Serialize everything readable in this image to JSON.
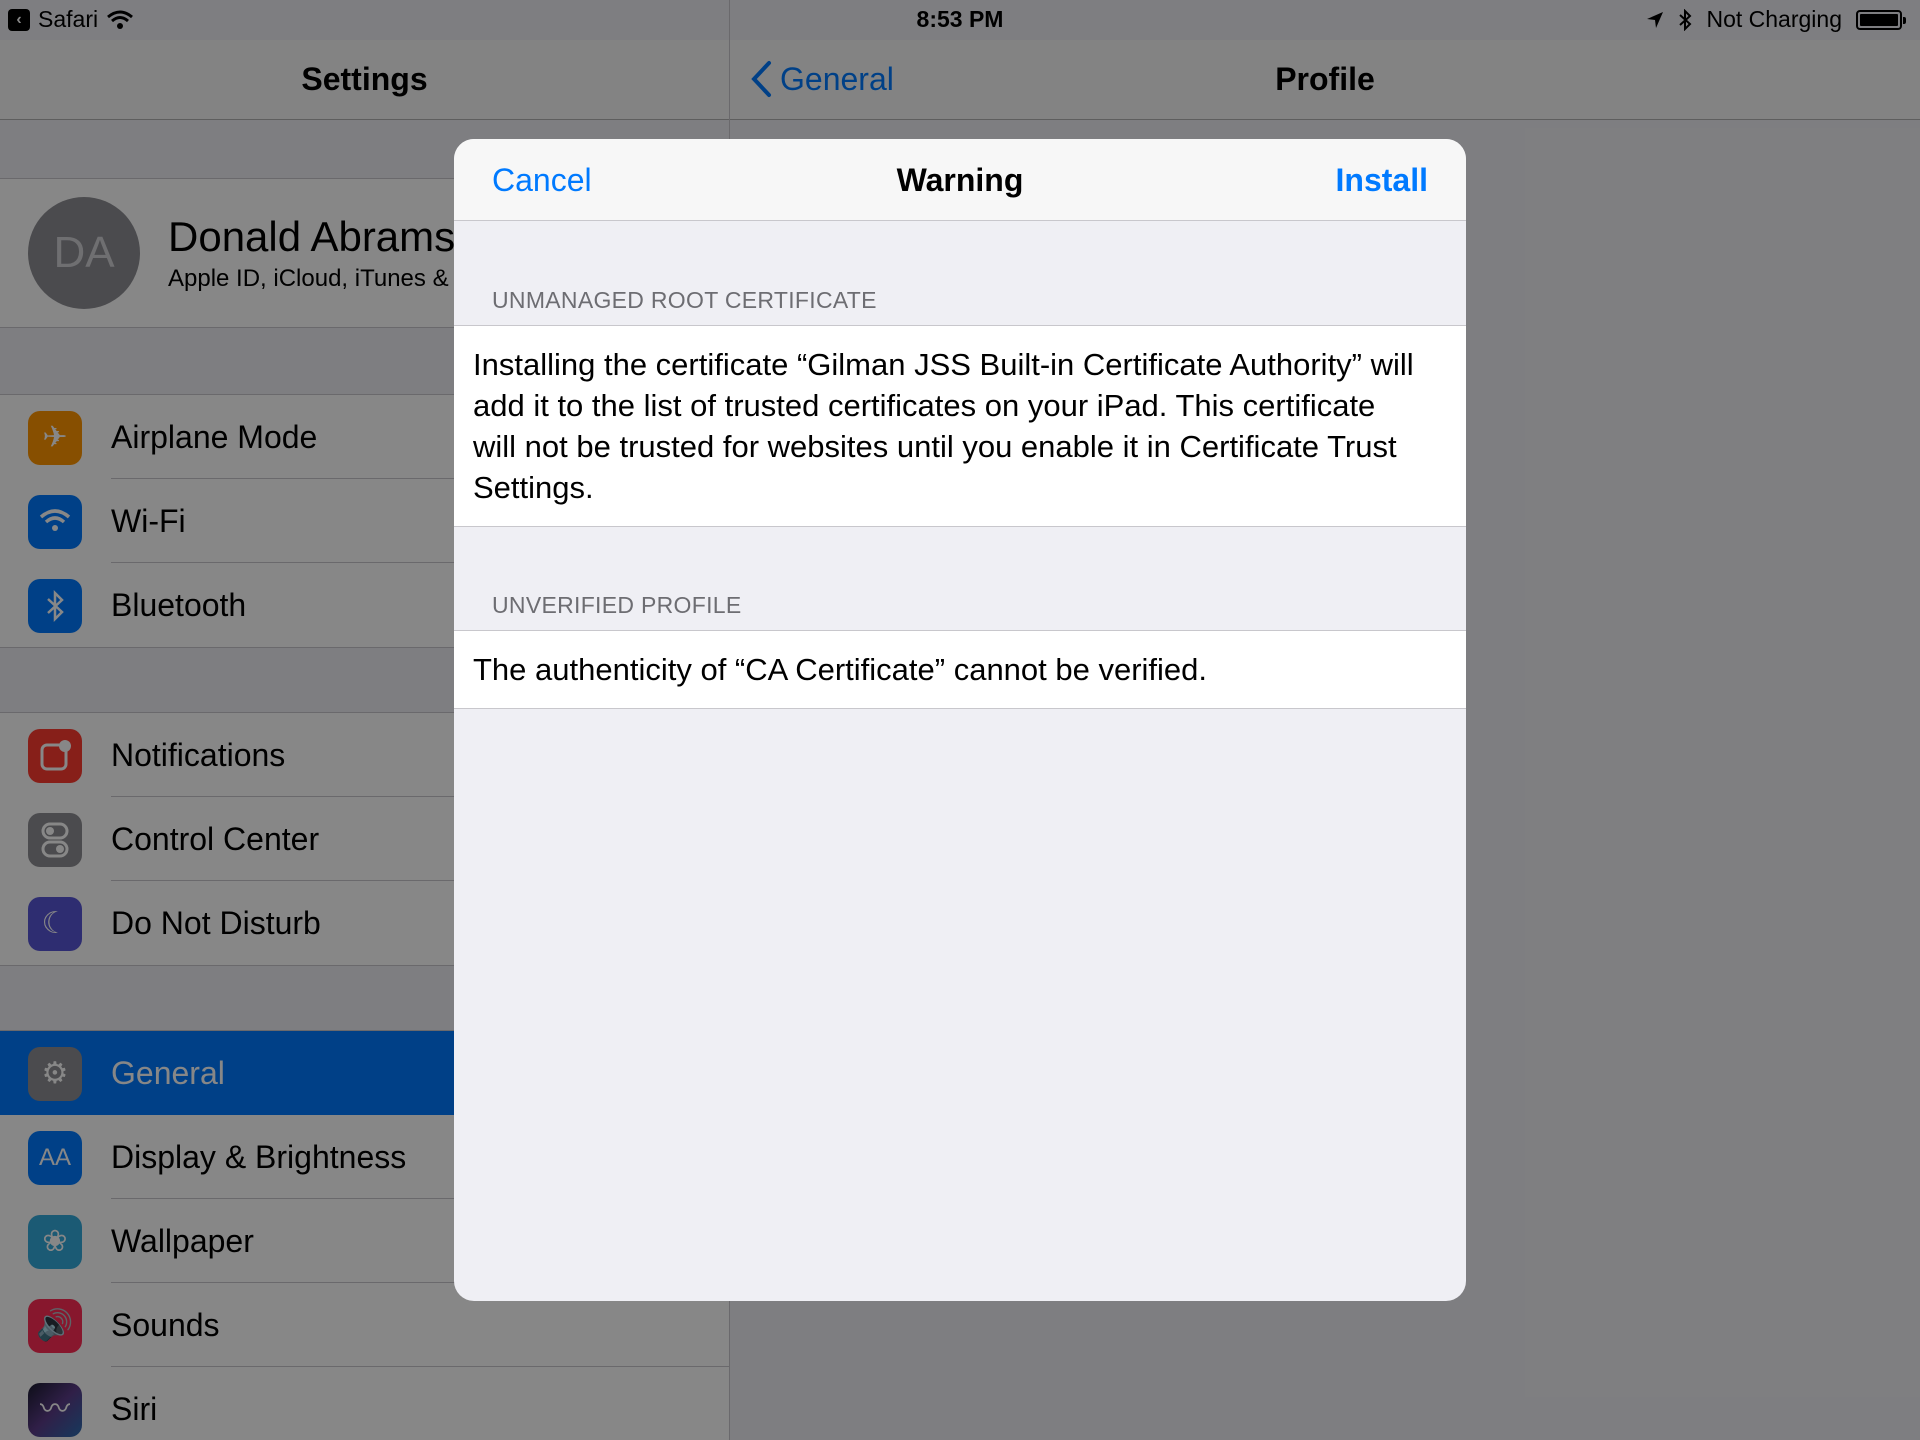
{
  "status_bar": {
    "back_app": "Safari",
    "time": "8:53 PM",
    "charging": "Not Charging"
  },
  "settings_nav": {
    "title": "Settings"
  },
  "profile_nav": {
    "back_label": "General",
    "title": "Profile"
  },
  "account": {
    "initials": "DA",
    "name": "Donald Abrams",
    "subtitle": "Apple ID, iCloud, iTunes &"
  },
  "groups": [
    [
      {
        "label": "Airplane Mode",
        "icon": "airplane-icon",
        "color": "#ff9500"
      },
      {
        "label": "Wi-Fi",
        "icon": "wifi-icon",
        "color": "#007aff"
      },
      {
        "label": "Bluetooth",
        "icon": "bluetooth-icon",
        "color": "#007aff"
      }
    ],
    [
      {
        "label": "Notifications",
        "icon": "notifications-icon",
        "color": "#ff3b30"
      },
      {
        "label": "Control Center",
        "icon": "control-center-icon",
        "color": "#8e8e93"
      },
      {
        "label": "Do Not Disturb",
        "icon": "moon-icon",
        "color": "#5856d6"
      }
    ],
    [
      {
        "label": "General",
        "icon": "gear-icon",
        "color": "#8e8e93",
        "selected": true
      },
      {
        "label": "Display & Brightness",
        "icon": "display-brightness-icon",
        "color": "#007aff"
      },
      {
        "label": "Wallpaper",
        "icon": "wallpaper-icon",
        "color": "#34aadc"
      },
      {
        "label": "Sounds",
        "icon": "speaker-icon",
        "color": "#ff2d55"
      },
      {
        "label": "Siri",
        "icon": "siri-icon",
        "color": "#000000"
      }
    ]
  ],
  "sheet": {
    "cancel": "Cancel",
    "title": "Warning",
    "install": "Install",
    "sections": [
      {
        "header": "UNMANAGED ROOT CERTIFICATE",
        "body": "Installing the certificate “Gilman JSS Built-in Certificate Authority” will add it to the list of trusted certificates on your iPad. This certificate will not be trusted for websites until you enable it in Certificate Trust Settings."
      },
      {
        "header": "UNVERIFIED PROFILE",
        "body": "The authenticity of “CA Certificate” cannot be verified."
      }
    ]
  },
  "colors": {
    "accent": "#007aff",
    "sheet_bg": "#efeff4",
    "dim": "rgba(0,0,0,0.47)"
  }
}
